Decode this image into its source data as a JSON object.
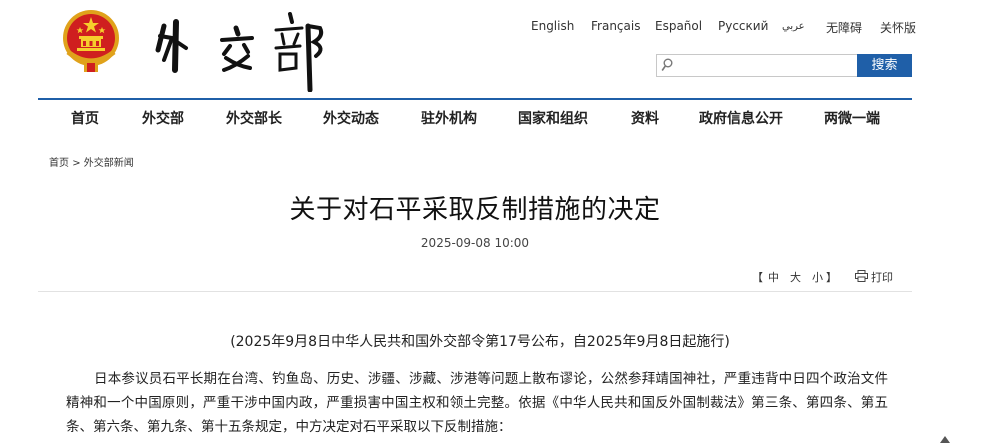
{
  "header": {
    "logo_text": "外交部",
    "languages": [
      "English",
      "Français",
      "Español",
      "Русский",
      "عربي",
      "无障碍",
      "关怀版"
    ],
    "search": {
      "placeholder": "",
      "button_label": "搜索"
    }
  },
  "nav": {
    "items": [
      "首页",
      "外交部",
      "外交部长",
      "外交动态",
      "驻外机构",
      "国家和组织",
      "资料",
      "政府信息公开",
      "两微一端"
    ]
  },
  "breadcrumb": {
    "home": "首页",
    "separator": ">",
    "section": "外交部新闻"
  },
  "article": {
    "title": "关于对石平采取反制措施的决定",
    "date": "2025-09-08 10:00",
    "toolbar": {
      "open_bracket": "【",
      "size_large": "中",
      "size_medium": "大",
      "size_small": "小",
      "close_bracket": "】",
      "print_label": "打印"
    },
    "subtitle": "(2025年9月8日中华人民共和国外交部令第17号公布，自2025年9月8日起施行)",
    "paragraph": "日本参议员石平长期在台湾、钓鱼岛、历史、涉疆、涉藏、涉港等问题上散布谬论，公然参拜靖国神社，严重违背中日四个政治文件精神和一个中国原则，严重干涉中国内政，严重损害中国主权和领土完整。依据《中华人民共和国反外国制裁法》第三条、第四条、第五条、第六条、第九条、第十五条规定，中方决定对石平采取以下反制措施："
  }
}
